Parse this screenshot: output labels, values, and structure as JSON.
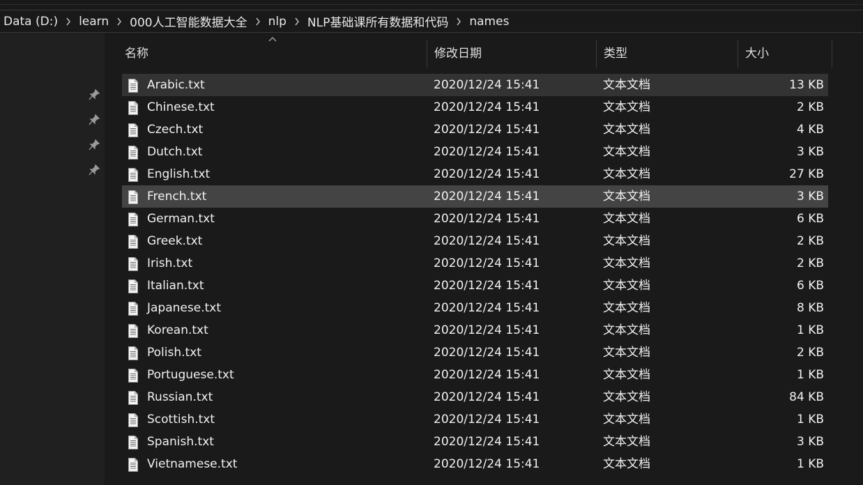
{
  "address_bar": {
    "crumbs": [
      "Data (D:)",
      "learn",
      "000人工智能数据大全",
      "nlp",
      "NLP基础课所有数据和代码",
      "names"
    ]
  },
  "columns": {
    "name": "名称",
    "date": "修改日期",
    "type": "类型",
    "size": "大小"
  },
  "icons": {
    "file": "text-file-icon",
    "pin": "pin-icon",
    "separator": "chevron-right-icon",
    "sort": "sort-up-icon"
  },
  "colors": {
    "background": "#1a1a1a",
    "selected_row": "#444444",
    "hover_row": "#333333"
  },
  "files": [
    {
      "name": "Arabic.txt",
      "date": "2020/12/24 15:41",
      "type": "文本文档",
      "size": "13 KB"
    },
    {
      "name": "Chinese.txt",
      "date": "2020/12/24 15:41",
      "type": "文本文档",
      "size": "2 KB"
    },
    {
      "name": "Czech.txt",
      "date": "2020/12/24 15:41",
      "type": "文本文档",
      "size": "4 KB"
    },
    {
      "name": "Dutch.txt",
      "date": "2020/12/24 15:41",
      "type": "文本文档",
      "size": "3 KB"
    },
    {
      "name": "English.txt",
      "date": "2020/12/24 15:41",
      "type": "文本文档",
      "size": "27 KB"
    },
    {
      "name": "French.txt",
      "date": "2020/12/24 15:41",
      "type": "文本文档",
      "size": "3 KB"
    },
    {
      "name": "German.txt",
      "date": "2020/12/24 15:41",
      "type": "文本文档",
      "size": "6 KB"
    },
    {
      "name": "Greek.txt",
      "date": "2020/12/24 15:41",
      "type": "文本文档",
      "size": "2 KB"
    },
    {
      "name": "Irish.txt",
      "date": "2020/12/24 15:41",
      "type": "文本文档",
      "size": "2 KB"
    },
    {
      "name": "Italian.txt",
      "date": "2020/12/24 15:41",
      "type": "文本文档",
      "size": "6 KB"
    },
    {
      "name": "Japanese.txt",
      "date": "2020/12/24 15:41",
      "type": "文本文档",
      "size": "8 KB"
    },
    {
      "name": "Korean.txt",
      "date": "2020/12/24 15:41",
      "type": "文本文档",
      "size": "1 KB"
    },
    {
      "name": "Polish.txt",
      "date": "2020/12/24 15:41",
      "type": "文本文档",
      "size": "2 KB"
    },
    {
      "name": "Portuguese.txt",
      "date": "2020/12/24 15:41",
      "type": "文本文档",
      "size": "1 KB"
    },
    {
      "name": "Russian.txt",
      "date": "2020/12/24 15:41",
      "type": "文本文档",
      "size": "84 KB"
    },
    {
      "name": "Scottish.txt",
      "date": "2020/12/24 15:41",
      "type": "文本文档",
      "size": "1 KB"
    },
    {
      "name": "Spanish.txt",
      "date": "2020/12/24 15:41",
      "type": "文本文档",
      "size": "3 KB"
    },
    {
      "name": "Vietnamese.txt",
      "date": "2020/12/24 15:41",
      "type": "文本文档",
      "size": "1 KB"
    }
  ]
}
